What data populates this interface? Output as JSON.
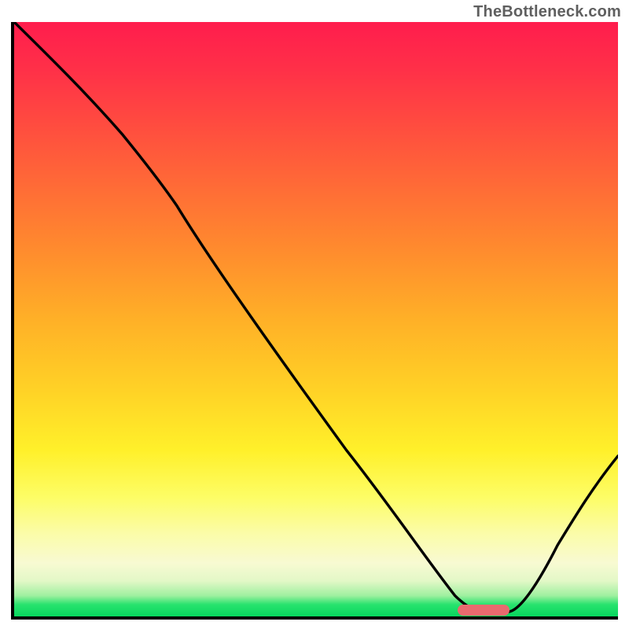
{
  "watermark": "TheBottleneck.com",
  "colors": {
    "axis": "#000000",
    "curve": "#000000",
    "marker": "#e96a6f",
    "gradient_top": "#ff1d4d",
    "gradient_bottom": "#07d75e"
  },
  "chart_data": {
    "type": "line",
    "title": "",
    "xlabel": "",
    "ylabel": "",
    "xlim": [
      0,
      100
    ],
    "ylim": [
      0,
      100
    ],
    "grid": false,
    "legend": false,
    "note": "No numeric axis tick labels are rendered in the image; x/y values are spatial estimates on a 0–100 scale read from pixel positions.",
    "series": [
      {
        "name": "bottleneck-curve",
        "x": [
          0,
          8,
          16,
          22,
          27,
          40,
          55,
          67,
          73,
          77,
          82,
          88,
          94,
          100
        ],
        "y": [
          100,
          92,
          84,
          76,
          69,
          49,
          28,
          11,
          3,
          1,
          1,
          8,
          17,
          27
        ]
      }
    ],
    "marker": {
      "name": "optimum-range",
      "x_start": 74,
      "x_end": 82,
      "y": 0.7
    }
  }
}
